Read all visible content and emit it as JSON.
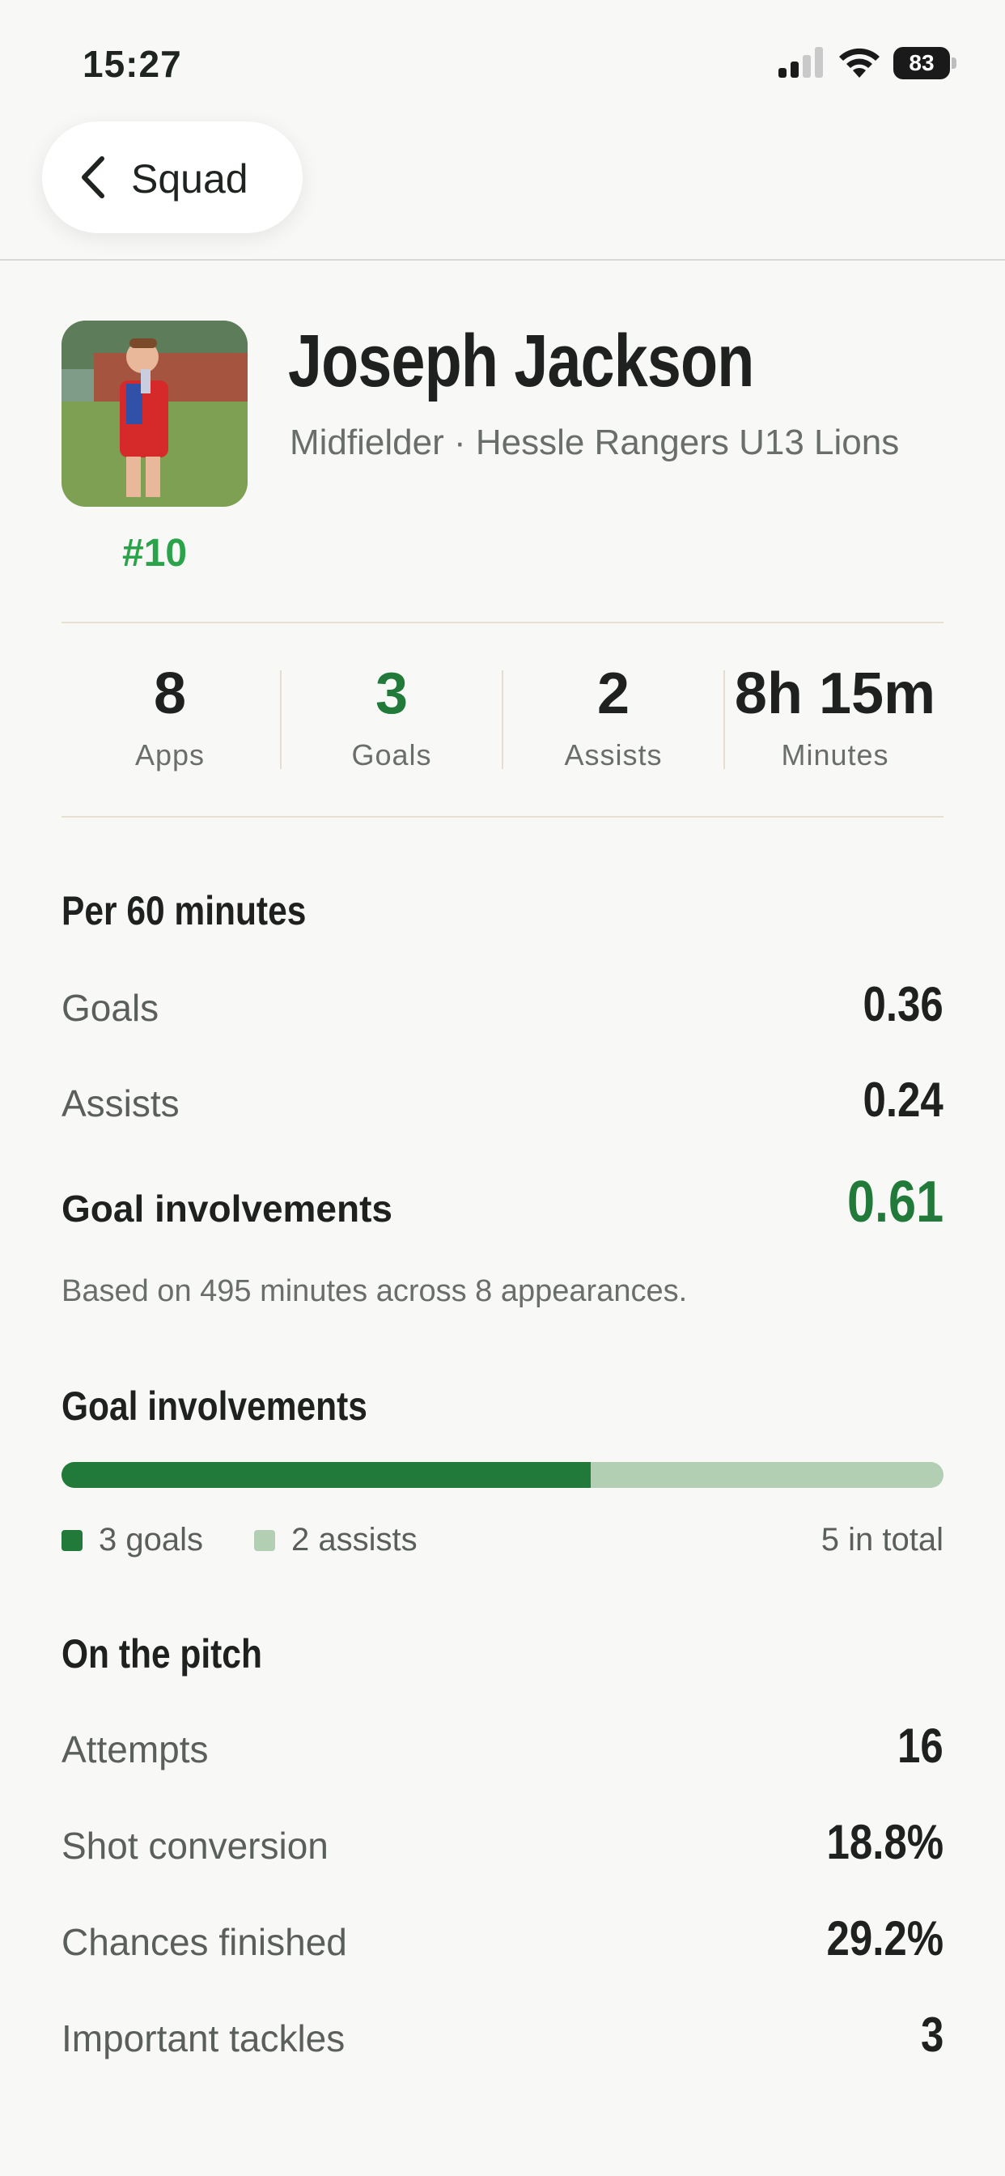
{
  "status_bar": {
    "time": "15:27",
    "battery": "83"
  },
  "nav": {
    "back_label": "Squad"
  },
  "player": {
    "name": "Joseph Jackson",
    "subtitle": "Midfielder · Hessle Rangers U13 Lions",
    "number": "#10"
  },
  "summary": [
    {
      "value": "8",
      "label": "Apps"
    },
    {
      "value": "3",
      "label": "Goals"
    },
    {
      "value": "2",
      "label": "Assists"
    },
    {
      "value": "8h 15m",
      "label": "Minutes"
    }
  ],
  "per60": {
    "title": "Per 60 minutes",
    "rows": [
      {
        "label": "Goals",
        "value": "0.36"
      },
      {
        "label": "Assists",
        "value": "0.24"
      },
      {
        "label": "Goal involvements",
        "value": "0.61"
      }
    ],
    "note": "Based on 495 minutes across 8 appearances."
  },
  "involvements": {
    "title": "Goal involvements",
    "goals_fraction": 0.6,
    "goals_label": "3 goals",
    "assists_label": "2 assists",
    "total_label": "5 in total",
    "colors": {
      "goals": "#227a3a",
      "assists": "#b2cfb3"
    }
  },
  "pitch": {
    "title": "On the pitch",
    "rows": [
      {
        "label": "Attempts",
        "value": "16"
      },
      {
        "label": "Shot conversion",
        "value": "18.8%"
      },
      {
        "label": "Chances finished",
        "value": "29.2%"
      },
      {
        "label": "Important tackles",
        "value": "3"
      }
    ]
  },
  "colors": {
    "accent_green": "#227a3a",
    "jersey_green": "#2aa34a",
    "background": "#f8f8f6"
  }
}
